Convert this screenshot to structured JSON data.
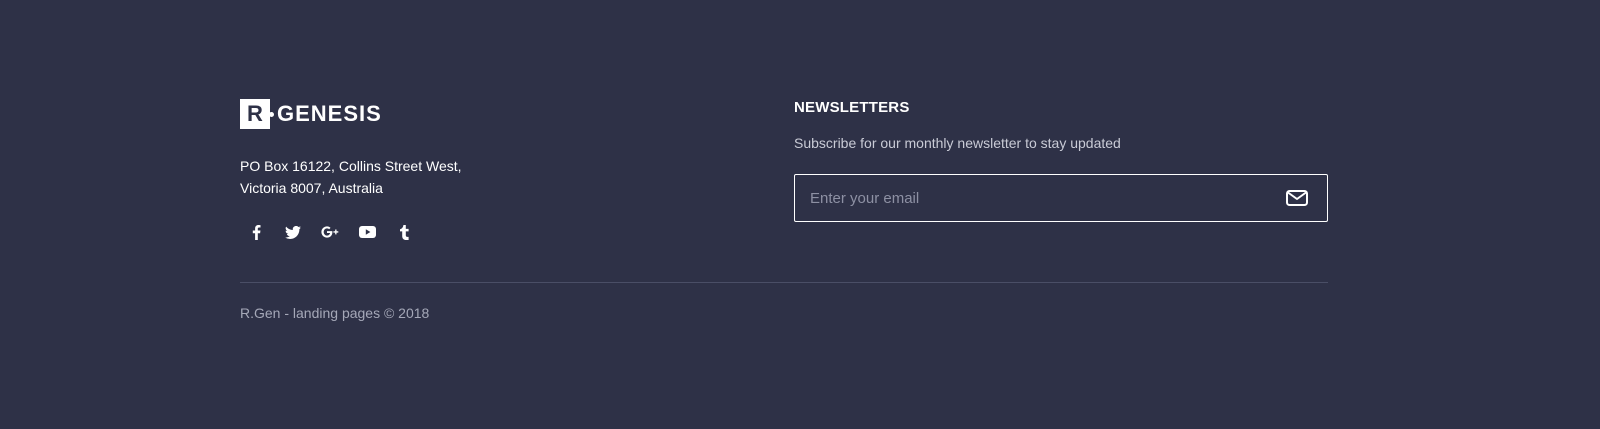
{
  "brand": {
    "mark_letter": "R",
    "wordmark": "GENESIS"
  },
  "address": {
    "line1": "PO Box 16122, Collins Street West,",
    "line2": "Victoria 8007, Australia"
  },
  "socials": [
    {
      "name": "facebook-icon"
    },
    {
      "name": "twitter-icon"
    },
    {
      "name": "google-plus-icon"
    },
    {
      "name": "youtube-icon"
    },
    {
      "name": "tumblr-icon"
    }
  ],
  "newsletter": {
    "title": "NEWSLETTERS",
    "subtitle": "Subscribe for our monthly newsletter to stay updated",
    "placeholder": "Enter your email",
    "value": "",
    "button_icon": "envelope-icon"
  },
  "footer": {
    "copyright": "R.Gen - landing pages © 2018"
  },
  "colors": {
    "background": "#2e3147",
    "text": "#ffffff",
    "muted": "#a5a8b8",
    "divider": "#4a4e66"
  }
}
